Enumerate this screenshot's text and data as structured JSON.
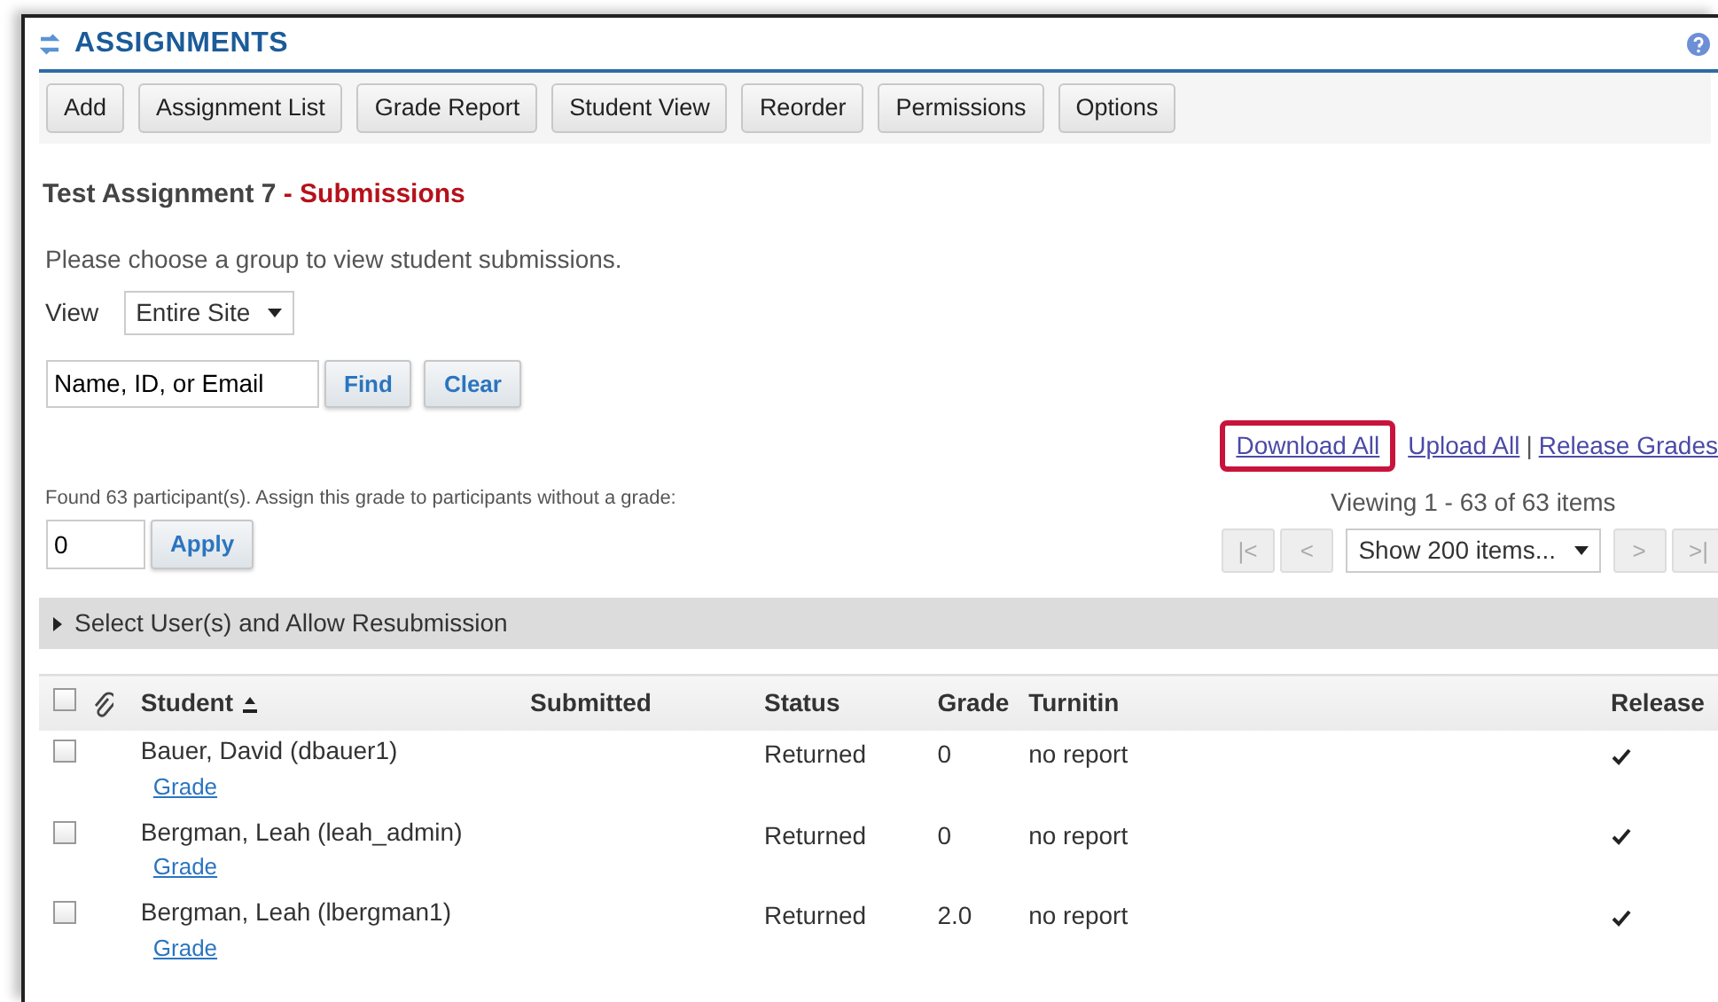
{
  "tool": {
    "title": "ASSIGNMENTS"
  },
  "toolbar": [
    {
      "label": "Add"
    },
    {
      "label": "Assignment List"
    },
    {
      "label": "Grade Report"
    },
    {
      "label": "Student View"
    },
    {
      "label": "Reorder"
    },
    {
      "label": "Permissions"
    },
    {
      "label": "Options"
    }
  ],
  "heading": {
    "title": "Test Assignment 7",
    "separator": "-",
    "subtitle": "Submissions"
  },
  "instruction": "Please choose a group to view student submissions.",
  "view": {
    "label": "View",
    "value": "Entire Site"
  },
  "search": {
    "value": "Name, ID, or Email",
    "find": "Find",
    "clear": "Clear"
  },
  "actions": [
    {
      "label": "Download All",
      "highlighted": true
    },
    {
      "label": "Upload All",
      "highlighted": false
    },
    {
      "label": "Release Grades",
      "highlighted": false
    }
  ],
  "action_separator": "|",
  "found": "Found 63 participant(s). Assign this grade to participants without a grade:",
  "default_grade": {
    "value": "0",
    "apply": "Apply"
  },
  "pager": {
    "viewing": "Viewing 1 - 63 of 63 items",
    "page_size": "Show 200 items...",
    "buttons": [
      {
        "label": "|<",
        "disabled": true
      },
      {
        "label": "<",
        "disabled": true
      },
      {
        "label": ">",
        "disabled": true
      },
      {
        "label": ">|",
        "disabled": true
      }
    ]
  },
  "resubmission": {
    "label": "Select User(s) and Allow Resubmission",
    "expanded": false
  },
  "table": {
    "select_all": false,
    "columns": [
      "Student",
      "Submitted",
      "Status",
      "Grade",
      "Turnitin",
      "Release"
    ],
    "rows": [
      {
        "checked": false,
        "student": "Bauer, David (dbauer1)",
        "link": "Grade",
        "submitted": "",
        "status": "Returned",
        "grade": "0",
        "turnitin": "no report",
        "released": true
      },
      {
        "checked": false,
        "student": "Bergman, Leah (leah_admin)",
        "link": "Grade",
        "submitted": "",
        "status": "Returned",
        "grade": "0",
        "turnitin": "no report",
        "released": true
      },
      {
        "checked": false,
        "student": "Bergman, Leah (lbergman1)",
        "link": "Grade",
        "submitted": "",
        "status": "Returned",
        "grade": "2.0",
        "turnitin": "no report",
        "released": true
      }
    ]
  }
}
